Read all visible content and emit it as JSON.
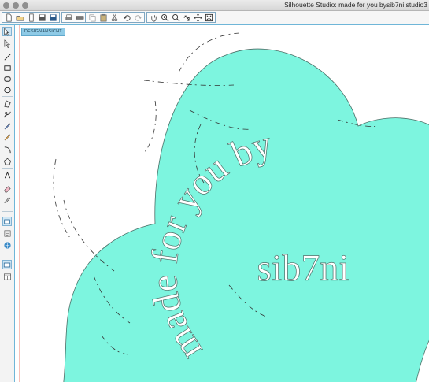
{
  "window": {
    "title": "Silhouette Studio: made for you bysib7ni.studio3"
  },
  "toolbar": {
    "groups": [
      [
        "new-document-icon",
        "open-folder-icon",
        "new-page-icon",
        "save-icon",
        "save-as-icon"
      ],
      [
        "print-icon",
        "send-to-cutter-icon"
      ],
      [
        "copy-icon",
        "paste-icon",
        "cut-icon"
      ],
      [
        "undo-icon",
        "redo-icon"
      ],
      [
        "pan-hand-icon",
        "zoom-in-icon",
        "zoom-out-icon",
        "zoom-select-icon",
        "move-arrows-icon",
        "fit-to-page-icon"
      ]
    ]
  },
  "sidebar": {
    "tools": [
      "select-arrow-icon",
      "point-edit-icon",
      "line-icon",
      "rectangle-icon",
      "rounded-rectangle-icon",
      "ellipse-icon",
      "polygon-icon",
      "curve-icon",
      "freehand-icon",
      "smooth-freehand-icon",
      "arc-icon",
      "regular-polygon-icon",
      "text-icon",
      "eraser-icon",
      "knife-icon",
      "design-page-icon",
      "library-icon",
      "silhouette-store-icon",
      "page-view-icon",
      "split-view-icon"
    ]
  },
  "canvas": {
    "tab_label": "DESIGNANSICHT",
    "arc_text": "made for you by",
    "name_text": "sib7ni",
    "colors": {
      "shape_fill": "#7df5df",
      "shape_stroke": "#4a6e66",
      "margin_line": "#f08070",
      "accent": "#6fb6d8"
    }
  }
}
